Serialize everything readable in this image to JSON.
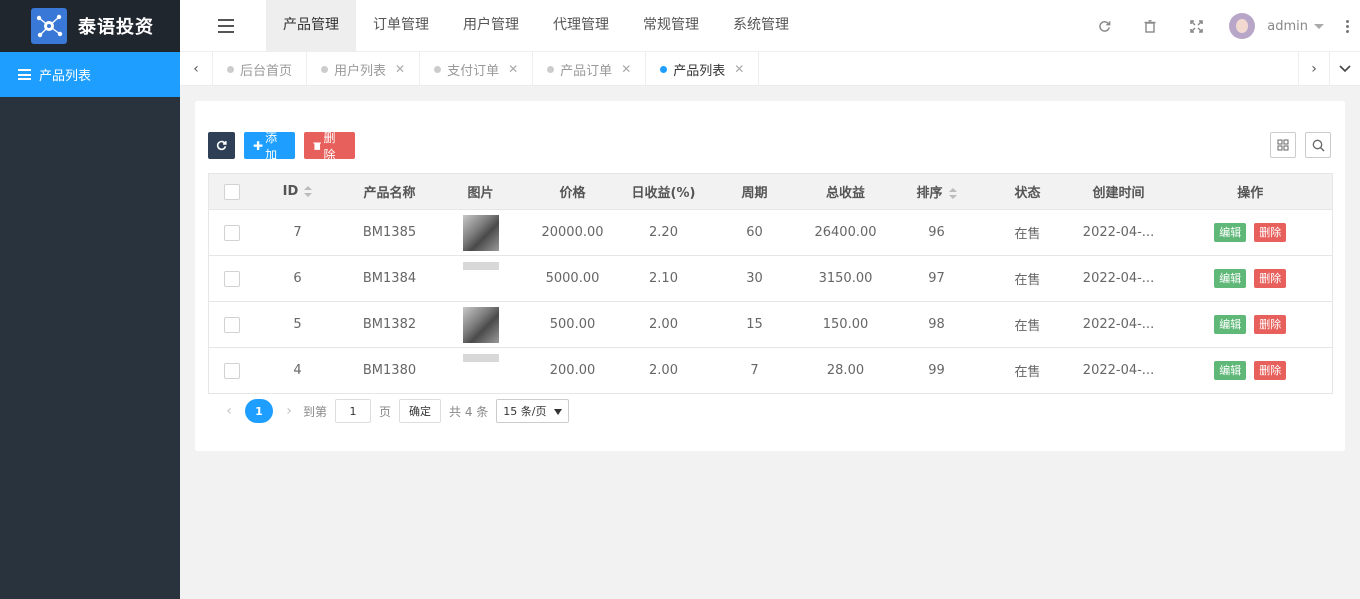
{
  "app": {
    "title": "泰语投资"
  },
  "sidebar": {
    "items": [
      {
        "label": "产品列表",
        "icon": "list-icon"
      }
    ]
  },
  "header": {
    "nav": [
      "产品管理",
      "订单管理",
      "用户管理",
      "代理管理",
      "常规管理",
      "系统管理"
    ],
    "active_nav": "产品管理",
    "user": "admin"
  },
  "tabs": [
    {
      "label": "后台首页",
      "closable": false
    },
    {
      "label": "用户列表",
      "closable": true
    },
    {
      "label": "支付订单",
      "closable": true
    },
    {
      "label": "产品订单",
      "closable": true
    },
    {
      "label": "产品列表",
      "closable": true,
      "active": true
    }
  ],
  "toolbar": {
    "add_label": "添加",
    "delete_label": "删除"
  },
  "table": {
    "columns": [
      "ID",
      "产品名称",
      "图片",
      "价格",
      "日收益(%)",
      "周期",
      "总收益",
      "排序",
      "状态",
      "创建时间",
      "操作"
    ],
    "rows": [
      {
        "id": "7",
        "name": "BM1385",
        "price": "20000.00",
        "daily": "2.20",
        "period": "60",
        "total": "26400.00",
        "sort": "96",
        "status": "在售",
        "created": "2022-04-...",
        "edit": "编辑",
        "del": "删除"
      },
      {
        "id": "6",
        "name": "BM1384",
        "price": "5000.00",
        "daily": "2.10",
        "period": "30",
        "total": "3150.00",
        "sort": "97",
        "status": "在售",
        "created": "2022-04-...",
        "edit": "编辑",
        "del": "删除"
      },
      {
        "id": "5",
        "name": "BM1382",
        "price": "500.00",
        "daily": "2.00",
        "period": "15",
        "total": "150.00",
        "sort": "98",
        "status": "在售",
        "created": "2022-04-...",
        "edit": "编辑",
        "del": "删除"
      },
      {
        "id": "4",
        "name": "BM1380",
        "price": "200.00",
        "daily": "2.00",
        "period": "7",
        "total": "28.00",
        "sort": "99",
        "status": "在售",
        "created": "2022-04-...",
        "edit": "编辑",
        "del": "删除"
      }
    ]
  },
  "pager": {
    "current": "1",
    "goto_label": "到第",
    "page_value": "1",
    "page_unit": "页",
    "confirm": "确定",
    "total": "共 4 条",
    "per_page": "15 条/页"
  },
  "colors": {
    "accent": "#1e9fff",
    "sidebar": "#28333e",
    "danger": "#e7605c",
    "success": "#5fb878"
  }
}
